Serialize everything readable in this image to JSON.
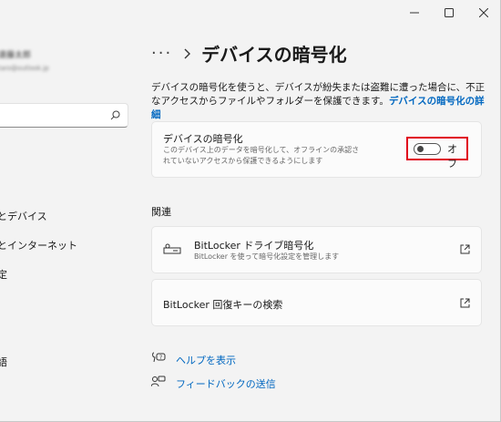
{
  "window": {
    "minimize_label": "minimize",
    "maximize_label": "maximize",
    "close_label": "close"
  },
  "sidebar": {
    "user_name": "遠藤太郎",
    "user_email": "taro@outlook.jp",
    "search_placeholder": "",
    "items": [
      {
        "label": "とデバイス"
      },
      {
        "label": "とインターネット"
      },
      {
        "label": "定"
      },
      {
        "label": "語"
      }
    ]
  },
  "header": {
    "breadcrumb_more": "···",
    "page_title": "デバイスの暗号化"
  },
  "main": {
    "description": "デバイスの暗号化を使うと、デバイスが紛失または盗難に遭った場合に、不正なアクセスからファイルやフォルダーを保護できます。",
    "description_link": "デバイスの暗号化の詳細",
    "encryption_card": {
      "title": "デバイスの暗号化",
      "subtitle": "このデバイス上のデータを暗号化して、オフラインの承認されていないアクセスから保護できるようにします",
      "toggle_state": "off",
      "toggle_label": "オフ"
    },
    "related_title": "関連",
    "related": [
      {
        "title": "BitLocker ドライブ暗号化",
        "subtitle": "BitLocker を使って暗号化設定を管理します",
        "icon": "bitlocker-key-icon"
      },
      {
        "title": "BitLocker 回復キーの検索",
        "subtitle": "",
        "icon": "external-link-icon"
      }
    ],
    "help_links": [
      {
        "label": "ヘルプを表示",
        "icon": "help-icon"
      },
      {
        "label": "フィードバックの送信",
        "icon": "feedback-icon"
      }
    ]
  },
  "colors": {
    "accent": "#0067c0",
    "highlight": "#e0001b",
    "background": "#f3f3f3",
    "card": "#fbfbfb"
  }
}
